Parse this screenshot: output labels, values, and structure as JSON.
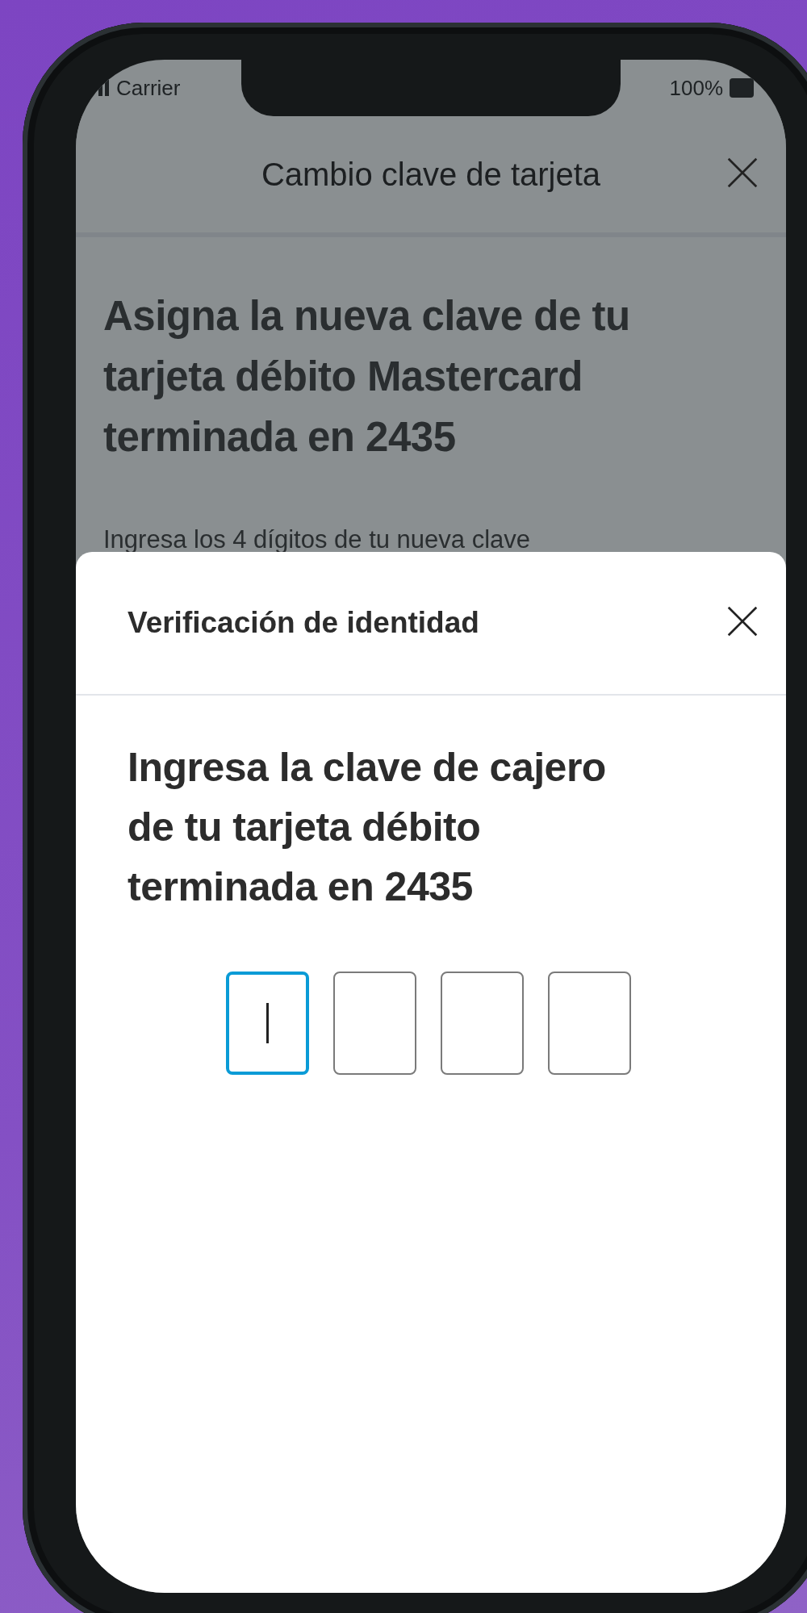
{
  "status_bar": {
    "carrier": "Carrier",
    "battery": "100%"
  },
  "nav": {
    "title": "Cambio clave de tarjeta"
  },
  "page": {
    "heading": "Asigna la nueva clave de tu tarjeta débito Mastercard terminada en 2435",
    "instruction": "Ingresa los 4 dígitos de tu nueva clave"
  },
  "sheet": {
    "title": "Verificación de identidad",
    "heading": "Ingresa la clave de cajero de tu tarjeta débito terminada en 2435",
    "pin_fields": [
      {
        "selected": true
      },
      {
        "selected": false
      },
      {
        "selected": false
      },
      {
        "selected": false
      }
    ]
  }
}
